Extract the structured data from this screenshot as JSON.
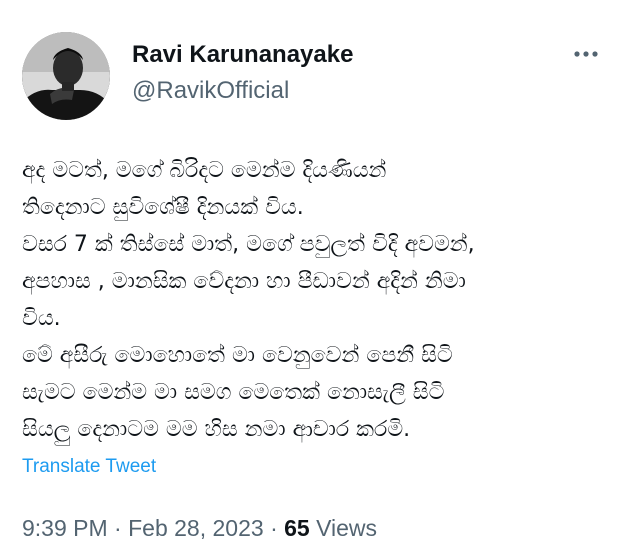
{
  "author": {
    "display_name": "Ravi Karunanayake",
    "handle": "@RavikOfficial",
    "avatar_icon": "profile-photo-person"
  },
  "more_icon": "more-horizontal-icon",
  "tweet": {
    "lines": [
      "අද මටත්, මගේ බිරිදට මෙන්ම දියණියන්",
      "තිදෙනාට සුවිශේෂී දිනයක් විය.",
      "වසර 7 ක් තිස්සේ මාත්, මගේ පවුලත් විදි අවමන්,",
      "අපහාස , මානසික වේදනා හා පීඩාවන් අදින් නිමා",
      "විය.",
      "මේ අසීරු මොහොතේ මා වෙනුවෙන් පෙනී සිටි",
      "සැමට මෙන්ම මා සමග මෙතෙක් නොසැලී  සිටි",
      "සියලු දෙනාටම මම හිස නමා ආචාර කරමි."
    ],
    "translate_label": "Translate Tweet"
  },
  "meta": {
    "time": "9:39 PM",
    "separator": "·",
    "date": "Feb 28, 2023",
    "views_count": "65",
    "views_label": "Views"
  },
  "colors": {
    "text": "#0f1419",
    "secondary": "#536471",
    "link": "#1d9bf0"
  }
}
